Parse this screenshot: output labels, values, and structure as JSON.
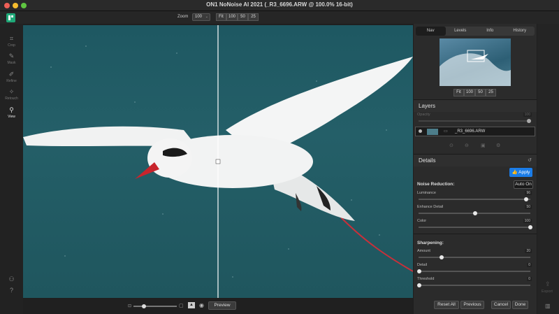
{
  "window": {
    "title": "ON1 NoNoise AI 2021 (_R3_6696.ARW @ 100.0% 16-bit)"
  },
  "toolbar": {
    "zoom_label": "Zoom",
    "zoom_value": "100",
    "zoom_buttons": [
      "Fit",
      "100",
      "50",
      "25"
    ]
  },
  "tools": [
    {
      "label": "Crop",
      "icon": "crop-icon"
    },
    {
      "label": "Mask",
      "icon": "mask-brush-icon"
    },
    {
      "label": "Refine",
      "icon": "refine-brush-icon"
    },
    {
      "label": "Retouch",
      "icon": "retouch-icon"
    },
    {
      "label": "View",
      "icon": "view-magnifier-icon"
    }
  ],
  "panel": {
    "tabs": [
      "Nav",
      "Levels",
      "Info",
      "History"
    ],
    "active_tab": "Nav",
    "nav_buttons": [
      "Fit",
      "100",
      "50",
      "25"
    ],
    "layers": {
      "title": "Layers",
      "opacity_label": "Opacity",
      "opacity_value": "100",
      "layer_name": "_R3_6696.ARW"
    },
    "details": {
      "title": "Details",
      "apply_label": "Apply",
      "noise_label": "Noise Reduction:",
      "auto_label": "Auto On",
      "sliders_noise": [
        {
          "label": "Luminance",
          "value": "96"
        },
        {
          "label": "Enhance Detail",
          "value": "50"
        },
        {
          "label": "Color",
          "value": "100"
        }
      ],
      "sharpen_label": "Sharpening:",
      "sliders_sharpen": [
        {
          "label": "Amount",
          "value": "20"
        },
        {
          "label": "Detail",
          "value": "0"
        },
        {
          "label": "Threshold",
          "value": "0"
        }
      ]
    }
  },
  "bottom": {
    "preview_label": "Preview",
    "reset_label": "Reset All",
    "previous_label": "Previous",
    "cancel_label": "Cancel",
    "done_label": "Done"
  },
  "export_label": "Export",
  "colors": {
    "accent": "#1a7ce8",
    "canvas": "#235e67",
    "beak": "#c8242c"
  }
}
